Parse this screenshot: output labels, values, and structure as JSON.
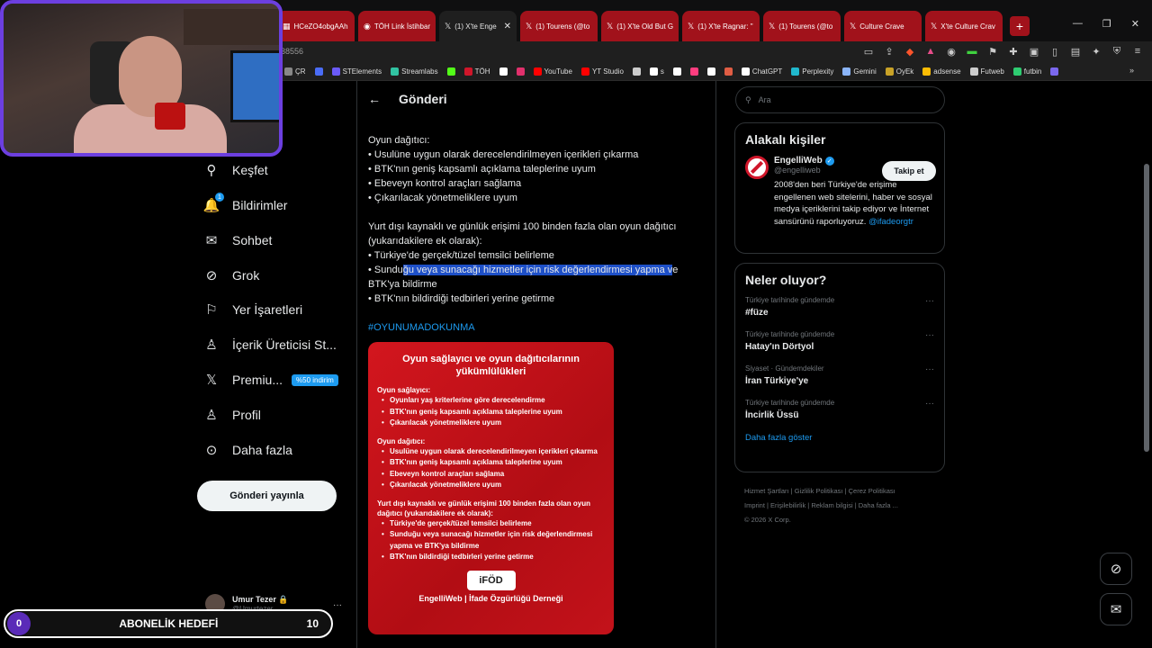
{
  "browser": {
    "tabs": [
      {
        "label": "HCeZO4obgAAh",
        "icon": "image-icon",
        "active": false
      },
      {
        "label": "TÖH Link İstihbar",
        "icon": "toh-icon",
        "active": false
      },
      {
        "label": "(1) X'te Enge",
        "icon": "x-logo-icon",
        "active": true
      },
      {
        "label": "(1) Tourens (@to",
        "icon": "x-logo-icon",
        "active": false
      },
      {
        "label": "(1) X'te Old But G",
        "icon": "x-logo-icon",
        "active": false
      },
      {
        "label": "(1) X'te Ragnar: \"",
        "icon": "x-logo-icon",
        "active": false
      },
      {
        "label": "(1) Tourens (@to",
        "icon": "x-logo-icon",
        "active": false
      },
      {
        "label": "Culture Crave",
        "icon": "x-logo-icon",
        "active": false
      },
      {
        "label": "X'te Culture Crav",
        "icon": "x-logo-icon",
        "active": false
      }
    ],
    "url_fragment": "38556",
    "bookmarks": [
      {
        "label": "ÇR",
        "color": "#888888"
      },
      {
        "label": "",
        "color": "#4a6cf7"
      },
      {
        "label": "STElements",
        "color": "#6a5af9"
      },
      {
        "label": "Streamlabs",
        "color": "#31c3a2"
      },
      {
        "label": "",
        "color": "#53fc18"
      },
      {
        "label": "TÖH",
        "color": "#d0162a"
      },
      {
        "label": "",
        "color": "#ffffff"
      },
      {
        "label": "",
        "color": "#e1306c"
      },
      {
        "label": "YouTube",
        "color": "#ff0000"
      },
      {
        "label": "YT Studio",
        "color": "#ff0000"
      },
      {
        "label": "",
        "color": "#cccccc"
      },
      {
        "label": "s",
        "color": "#ffffff"
      },
      {
        "label": "",
        "color": "#ffffff"
      },
      {
        "label": "",
        "color": "#ff3d7f"
      },
      {
        "label": "",
        "color": "#ffffff"
      },
      {
        "label": "",
        "color": "#e05d44"
      },
      {
        "label": "ChatGPT",
        "color": "#ffffff"
      },
      {
        "label": "Perplexity",
        "color": "#20b8cd"
      },
      {
        "label": "Gemini",
        "color": "#8ab4f8"
      },
      {
        "label": "OyEk",
        "color": "#c9a227"
      },
      {
        "label": "adsense",
        "color": "#fbbc04"
      },
      {
        "label": "Futweb",
        "color": "#cccccc"
      },
      {
        "label": "futbin",
        "color": "#2ecc71"
      },
      {
        "label": "",
        "color": "#7b68ee"
      }
    ]
  },
  "nav": {
    "items": [
      {
        "label": "Keşfet",
        "icon": "search-icon"
      },
      {
        "label": "Bildirimler",
        "icon": "bell-icon",
        "badge": "1"
      },
      {
        "label": "Sohbet",
        "icon": "mail-icon"
      },
      {
        "label": "Grok",
        "icon": "grok-icon"
      },
      {
        "label": "Yer İşaretleri",
        "icon": "bookmark-icon"
      },
      {
        "label": "İçerik Üreticisi St...",
        "icon": "creator-icon"
      },
      {
        "label": "Premiu...",
        "icon": "x-logo-icon",
        "badge": "%50 indirim"
      },
      {
        "label": "Profil",
        "icon": "person-icon"
      },
      {
        "label": "Daha fazla",
        "icon": "more-circle-icon"
      }
    ],
    "post_button": "Gönderi yayınla",
    "account": {
      "name": "Umur Tezer",
      "handle": "@Umurtezer"
    }
  },
  "goal_bar": {
    "start": "0",
    "title": "ABONELİK HEDEFİ",
    "end": "10"
  },
  "post": {
    "header_title": "Gönderi",
    "lines": [
      "Oyun dağıtıcı:",
      "• Usulüne uygun olarak derecelendirilmeyen içerikleri çıkarma",
      "• BTK'nın geniş kapsamlı açıklama taleplerine uyum",
      "• Ebeveyn kontrol araçları sağlama",
      "• Çıkarılacak yönetmeliklere uyum",
      "",
      "Yurt dışı kaynaklı ve günlük erişimi 100 binden fazla olan oyun dağıtıcı",
      "(yukarıdakilere ek olarak):",
      "• Türkiye'de gerçek/tüzel temsilci belirleme"
    ],
    "highlight_line": {
      "before": "• Sundu",
      "selected": "ğu veya sunacağı hizmetler için risk değerlendirmesi yapma v",
      "after": "e"
    },
    "lines_after": [
      "BTK'ya bildirme",
      "• BTK'nın bildirdiği tedbirleri yerine getirme"
    ],
    "hashtag": "#OYUNUMADOKUNMA",
    "card": {
      "title": "Oyun sağlayıcı ve oyun dağıtıcılarının yükümlülükleri",
      "sections": [
        {
          "heading": "Oyun sağlayıcı:",
          "items": [
            "Oyunları yaş kriterlerine göre derecelendirme",
            "BTK'nın geniş kapsamlı açıklama taleplerine uyum",
            "Çıkarılacak yönetmeliklere uyum"
          ]
        },
        {
          "heading": "Oyun dağıtıcı:",
          "items": [
            "Usulüne uygun olarak derecelendirilmeyen içerikleri çıkarma",
            "BTK'nın geniş kapsamlı açıklama taleplerine uyum",
            "Ebeveyn kontrol araçları sağlama",
            "Çıkarılacak yönetmeliklere uyum"
          ]
        },
        {
          "heading": "Yurt dışı kaynaklı ve günlük erişimi 100 binden fazla olan oyun dağıtıcı (yukarıdakilere ek olarak):",
          "items": [
            "Türkiye'de gerçek/tüzel temsilci belirleme",
            "Sunduğu veya sunacağı hizmetler için risk değerlendirmesi yapma ve BTK'ya bildirme",
            "BTK'nın bildirdiği tedbirleri yerine getirme"
          ]
        }
      ],
      "logo": "iFÖD",
      "footer": "EngelliWeb | İfade Özgürlüğü Derneği"
    }
  },
  "sidebar": {
    "search_placeholder": "Ara",
    "relevant": {
      "title": "Alakalı kişiler",
      "name": "EngelliWeb",
      "handle": "@engelliweb",
      "bio": "2008'den beri Türkiye'de erişime engellenen web sitelerini, haber ve sosyal medya içeriklerini takip ediyor ve İnternet sansürünü raporluyoruz.",
      "bio_link": "@ifadeorgtr",
      "follow": "Takip et"
    },
    "trends": {
      "title": "Neler oluyor?",
      "items": [
        {
          "context": "Türkiye tarihinde gündemde",
          "name": "#füze"
        },
        {
          "context": "Türkiye tarihinde gündemde",
          "name": "Hatay'ın Dörtyol"
        },
        {
          "context": "Siyaset · Gündemdekiler",
          "name": "İran Türkiye'ye"
        },
        {
          "context": "Türkiye tarihinde gündemde",
          "name": "İncirlik Üssü"
        }
      ],
      "show_more": "Daha fazla göster"
    },
    "footer_links": [
      "Hizmet Şartları",
      "Gizlilik Politikası",
      "Çerez Politikası",
      "Imprint",
      "Erişilebilirlik",
      "Reklam bilgisi",
      "Daha fazla ...",
      "© 2026 X Corp."
    ]
  }
}
